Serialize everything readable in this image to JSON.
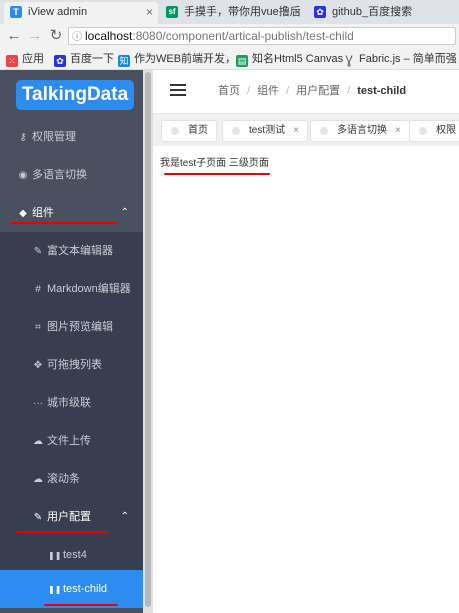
{
  "browser": {
    "tabs": [
      {
        "title": "iView admin",
        "icon": "iview-favicon",
        "color": "#2d8cf0",
        "glyph": "T"
      },
      {
        "title": "手摸手，带你用vue撸后",
        "icon": "sf-favicon",
        "color": "#009a61",
        "glyph": "sf"
      },
      {
        "title": "github_百度搜索",
        "icon": "baidu-favicon",
        "color": "#2932e1",
        "glyph": "✿"
      }
    ],
    "address": {
      "host": "localhost",
      "path": ":8080/component/artical-publish/test-child"
    },
    "bookmarks": [
      {
        "label": "应用",
        "icon": "apps-icon",
        "color": "#e44"
      },
      {
        "label": "百度一下",
        "icon": "baidu-icon",
        "color": "#2932e1"
      },
      {
        "label": "作为WEB前端开发，",
        "icon": "zhihu-icon",
        "color": "#0f88eb"
      },
      {
        "label": "知名Html5 Canvas",
        "icon": "page-icon",
        "color": "#1a9f5f"
      },
      {
        "label": "Fabric.js – 简单而强",
        "icon": "fabric-icon",
        "color": "#555"
      }
    ]
  },
  "sidebar": {
    "logo": "TalkingData",
    "items": [
      {
        "label": "权限管理",
        "icon": "key-icon",
        "glyph": "🗝"
      },
      {
        "label": "多语言切换",
        "icon": "globe-icon",
        "glyph": "◉"
      },
      {
        "label": "组件",
        "icon": "stack-icon",
        "glyph": "◆"
      },
      {
        "label": "富文本编辑器",
        "icon": "edit-icon",
        "glyph": "✎"
      },
      {
        "label": "Markdown编辑器",
        "icon": "hash-icon",
        "glyph": "#"
      },
      {
        "label": "图片预览编辑",
        "icon": "crop-icon",
        "glyph": "⌗"
      },
      {
        "label": "可拖拽列表",
        "icon": "move-icon",
        "glyph": "✥"
      },
      {
        "label": "城市级联",
        "icon": "more-icon",
        "glyph": "···"
      },
      {
        "label": "文件上传",
        "icon": "cloud-upload-icon",
        "glyph": "☁"
      },
      {
        "label": "滚动条",
        "icon": "cloud-icon",
        "glyph": "☁"
      },
      {
        "label": "用户配置",
        "icon": "edit-icon",
        "glyph": "✎"
      },
      {
        "label": "test4",
        "icon": "pause-icon",
        "glyph": "❚❚"
      },
      {
        "label": "test-child",
        "icon": "pause-icon",
        "glyph": "❚❚"
      }
    ]
  },
  "header": {
    "breadcrumb": [
      "首页",
      "组件",
      "用户配置",
      "test-child"
    ]
  },
  "tags": [
    {
      "label": "首页",
      "closable": false
    },
    {
      "label": "test测试",
      "closable": true
    },
    {
      "label": "多语言切换",
      "closable": true
    },
    {
      "label": "权限",
      "closable": false
    }
  ],
  "content": {
    "text": "我是test子页面 三级页面"
  }
}
